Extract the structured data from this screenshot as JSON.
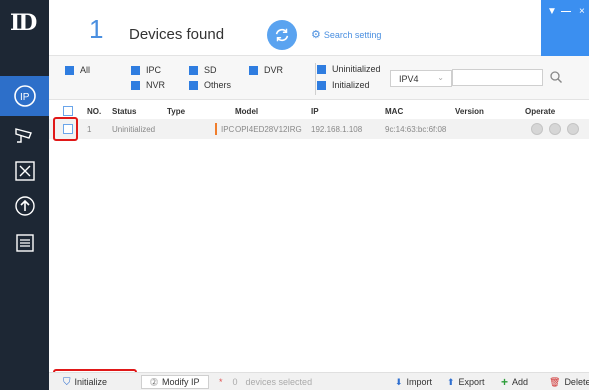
{
  "sidebar": {
    "logo": "ID",
    "items": [
      {
        "icon": "ip-icon",
        "active": true
      },
      {
        "icon": "camera-icon",
        "active": false
      },
      {
        "icon": "tools-icon",
        "active": false
      },
      {
        "icon": "upgrade-icon",
        "active": false
      },
      {
        "icon": "document-icon",
        "active": false
      }
    ]
  },
  "header": {
    "count": "1",
    "title": "Devices found",
    "search_setting": "Search setting"
  },
  "filters": {
    "all": "All",
    "ipc": "IPC",
    "sd": "SD",
    "dvr": "DVR",
    "nvr": "NVR",
    "others": "Others",
    "uninitialized": "Uninitialized",
    "initialized": "Initialized",
    "ip_version": "IPV4"
  },
  "table": {
    "columns": [
      "NO.",
      "Status",
      "Type",
      "Model",
      "IP",
      "MAC",
      "Version",
      "Operate"
    ],
    "rows": [
      {
        "no": "1",
        "status": "Uninitialized",
        "type": "IPC",
        "model": "OPI4ED28V12IRG",
        "ip": "192.168.1.108",
        "mac": "9c:14:63:bc:6f:08",
        "version": ""
      }
    ]
  },
  "footer": {
    "initialize": "Initialize",
    "modify_ip": "Modify IP",
    "selected_count": "0",
    "selected_text": "devices selected",
    "import": "Import",
    "export": "Export",
    "add": "Add",
    "delete": "Delete"
  },
  "colors": {
    "sidebar": "#1d2734",
    "accent": "#2f7de0",
    "highlight": "#e01818"
  }
}
